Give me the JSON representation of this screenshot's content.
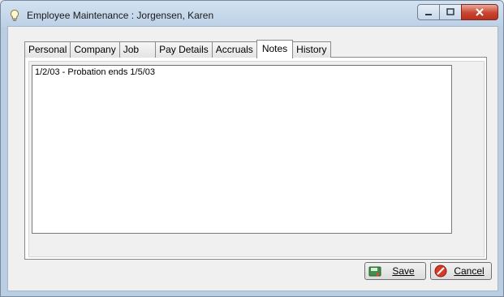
{
  "window": {
    "title": "Employee Maintenance : Jorgensen, Karen",
    "icon": "lightbulb-icon",
    "controls": [
      "minimize-icon",
      "maximize-icon",
      "close-icon"
    ]
  },
  "tabs": [
    {
      "label": "Personal"
    },
    {
      "label": "Company"
    },
    {
      "label": "Job"
    },
    {
      "label": "Pay Details"
    },
    {
      "label": "Accruals"
    },
    {
      "label": "Notes",
      "active": true
    },
    {
      "label": "History"
    }
  ],
  "notes": {
    "value": "1/2/03 - Probation ends 1/5/03"
  },
  "buttons": {
    "save_label": "Save",
    "save_icon": "save-icon",
    "cancel_label": "Cancel",
    "cancel_icon": "cancel-icon"
  },
  "colors": {
    "title_bar": "#bcd0e6",
    "close_button": "#c9452f",
    "dialog_background": "#f0f0f0"
  }
}
